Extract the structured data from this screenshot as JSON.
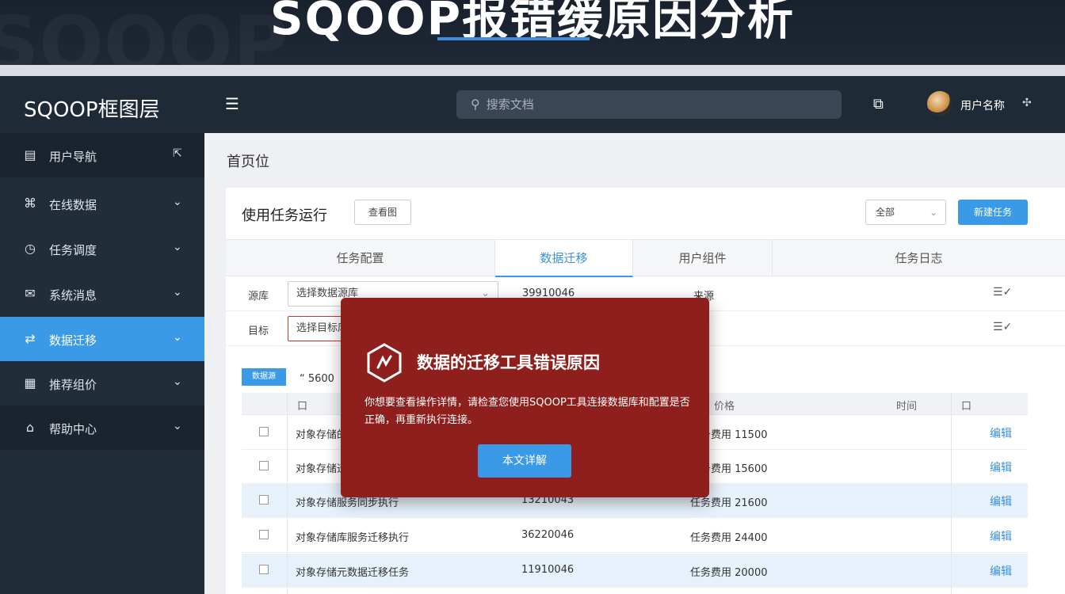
{
  "hero": {
    "title": "SQOOP报错缓原因分析"
  },
  "topbar": {
    "logo": "SQOOP框图层",
    "search_placeholder": "搜索文档",
    "username": "用户名称"
  },
  "sidebar": {
    "items": [
      {
        "label": "用户导航",
        "icon": "list-icon",
        "state": "dark"
      },
      {
        "label": "在线数据",
        "icon": "grid-icon",
        "state": "normal"
      },
      {
        "label": "任务调度",
        "icon": "clock-icon",
        "state": "normal"
      },
      {
        "label": "系统消息",
        "icon": "mail-icon",
        "state": "normal"
      },
      {
        "label": "数据迁移",
        "icon": "transfer-icon",
        "state": "active"
      },
      {
        "label": "推荐组价",
        "icon": "doc-icon",
        "state": "normal"
      },
      {
        "label": "帮助中心",
        "icon": "home-icon",
        "state": "dark"
      }
    ]
  },
  "main": {
    "heading": "首页位",
    "card_title": "使用任务运行",
    "small_button": "查看图",
    "select_value": "全部",
    "primary_button": "新建任务",
    "tabs": [
      "任务配置",
      "数据迁移",
      "用户组件",
      "任务日志"
    ],
    "form_rows": [
      {
        "label": "源库",
        "field": "选择数据源库",
        "num": "39910046",
        "price": "来源"
      },
      {
        "label": "目标",
        "field": "选择目标库",
        "num": "",
        "price": "库"
      }
    ],
    "table_badge": "数据源",
    "table_filter": "“ 5600",
    "table_headers": [
      "口",
      "价格",
      "时间",
      "口"
    ],
    "rows": [
      {
        "name": "对象存储的数据同步",
        "num": "",
        "price": "任务费用 11500",
        "hl": false
      },
      {
        "name": "对象存储迁移数据",
        "num": "",
        "price": "任务费用 15600",
        "hl": false
      },
      {
        "name": "对象存储服务同步执行",
        "num": "13210043",
        "price": "任务费用 21600",
        "hl": true
      },
      {
        "name": "对象存储库服务迁移执行",
        "num": "36220046",
        "price": "任务费用 24400",
        "hl": false
      },
      {
        "name": "对象存储元数据迁移任务",
        "num": "11910046",
        "price": "任务费用 20000",
        "hl": true
      }
    ],
    "row_action": "编辑"
  },
  "modal": {
    "title": "数据的迁移工具错误原因",
    "body": "你想要查看操作详情，请检查您使用SQOOP工具连接数据库和配置是否正确，再重新执行连接。",
    "button": "本文详解"
  },
  "colors": {
    "accent": "#3a9ae8",
    "modal_bg": "#8f1f1c",
    "sidebar_bg": "#222d3a"
  }
}
